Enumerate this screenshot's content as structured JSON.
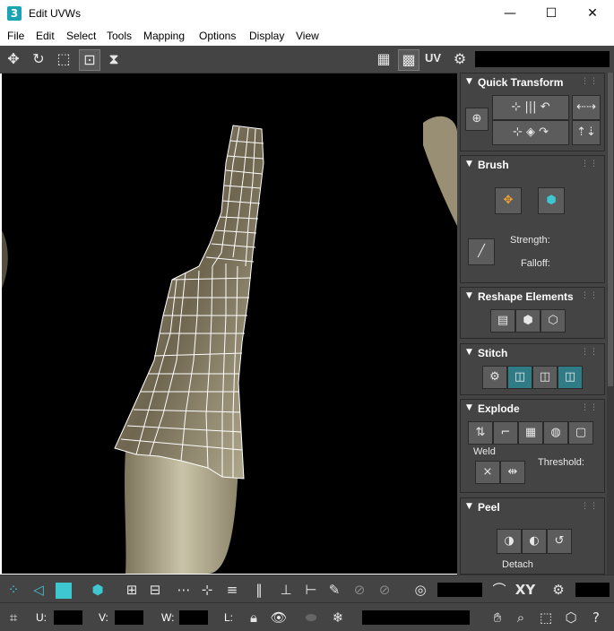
{
  "window": {
    "title": "Edit UVWs",
    "app_icon_text": "3",
    "minimize": "—",
    "maximize": "☐",
    "close": "✕"
  },
  "menu": [
    "File",
    "Edit",
    "Select",
    "Tools",
    "Mapping",
    "Options",
    "Display",
    "View"
  ],
  "toolbar": {
    "uv_label": "UV"
  },
  "rollouts": {
    "quick_transform": {
      "title": "Quick Transform"
    },
    "brush": {
      "title": "Brush",
      "strength_label": "Strength:",
      "falloff_label": "Falloff:"
    },
    "reshape": {
      "title": "Reshape Elements"
    },
    "stitch": {
      "title": "Stitch"
    },
    "explode": {
      "title": "Explode",
      "weld_label": "Weld",
      "threshold_label": "Threshold:"
    },
    "peel": {
      "title": "Peel",
      "detach_label": "Detach"
    }
  },
  "bottombar": {
    "xy_label": "XY"
  },
  "statusbar": {
    "u_label": "U:",
    "v_label": "V:",
    "w_label": "W:",
    "l_label": "L:"
  },
  "colors": {
    "panel_bg": "#444444",
    "accent": "#3ec7d1",
    "viewport_bg": "#000000",
    "mesh": "#ffffff"
  }
}
